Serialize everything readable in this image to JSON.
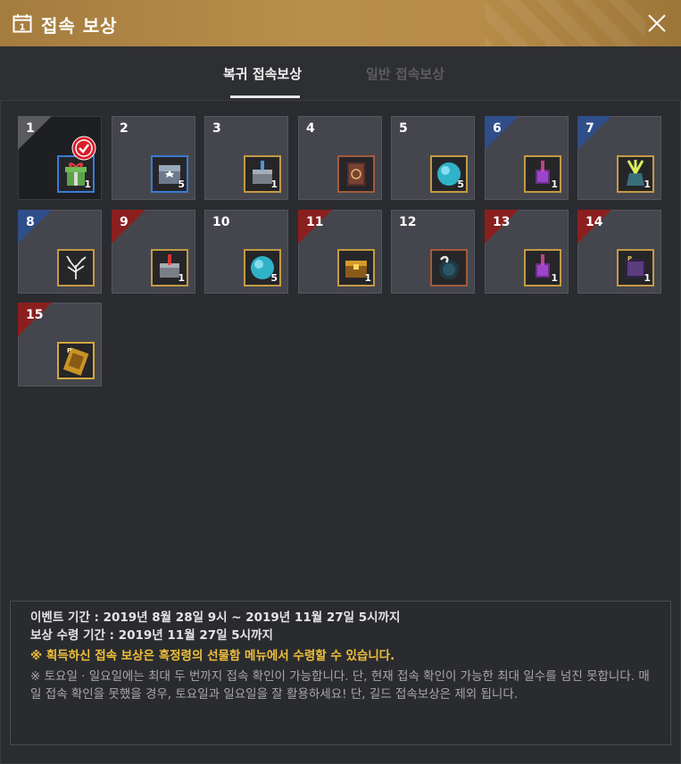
{
  "window": {
    "title": "접속 보상",
    "calendar_icon_label": "1"
  },
  "tabs": [
    {
      "label": "복귀 접속보상",
      "active": true
    },
    {
      "label": "일반 접속보상",
      "active": false
    }
  ],
  "rewards": [
    {
      "day": "1",
      "quantity": "1",
      "icon": "gift-box-icon",
      "ribbon": "gray",
      "frame": "blue",
      "claimed": true
    },
    {
      "day": "2",
      "quantity": "5",
      "icon": "silver-chest-icon",
      "ribbon": "none",
      "frame": "blue",
      "claimed": false
    },
    {
      "day": "3",
      "quantity": "1",
      "icon": "glowing-chest-icon",
      "ribbon": "none",
      "frame": "gold",
      "claimed": false
    },
    {
      "day": "4",
      "quantity": "",
      "icon": "spellbook-icon",
      "ribbon": "none",
      "frame": "brown",
      "claimed": false
    },
    {
      "day": "5",
      "quantity": "5",
      "icon": "blue-orb-icon",
      "ribbon": "none",
      "frame": "gold",
      "claimed": false
    },
    {
      "day": "6",
      "quantity": "1",
      "icon": "purple-cube-icon",
      "ribbon": "blue",
      "frame": "gold",
      "claimed": false
    },
    {
      "day": "7",
      "quantity": "1",
      "icon": "green-light-chest-icon",
      "ribbon": "blue",
      "frame": "gold",
      "claimed": false
    },
    {
      "day": "8",
      "quantity": "",
      "icon": "white-tree-icon",
      "ribbon": "blue",
      "frame": "gold",
      "claimed": false
    },
    {
      "day": "9",
      "quantity": "1",
      "icon": "red-light-chest-icon",
      "ribbon": "red",
      "frame": "gold",
      "claimed": false
    },
    {
      "day": "10",
      "quantity": "5",
      "icon": "blue-orb-icon",
      "ribbon": "none",
      "frame": "gold",
      "claimed": false
    },
    {
      "day": "11",
      "quantity": "1",
      "icon": "gold-chest-icon",
      "ribbon": "red",
      "frame": "gold",
      "claimed": false
    },
    {
      "day": "12",
      "quantity": "",
      "icon": "dark-orb-icon",
      "ribbon": "none",
      "frame": "brown",
      "claimed": false
    },
    {
      "day": "13",
      "quantity": "1",
      "icon": "purple-cube-icon",
      "ribbon": "red",
      "frame": "gold",
      "claimed": false
    },
    {
      "day": "14",
      "quantity": "1",
      "icon": "p-scroll-icon",
      "ribbon": "red",
      "frame": "gold",
      "claimed": false
    },
    {
      "day": "15",
      "quantity": "",
      "icon": "p-ticket-icon",
      "ribbon": "red",
      "frame": "yellow",
      "claimed": false
    }
  ],
  "notice": {
    "event_period": "이벤트 기간 : 2019년 8월 28일 9시 ~ 2019년 11월 27일 5시까지",
    "claim_period": "보상 수령 기간 : 2019년 11월 27일 5시까지",
    "highlight": "※ 획득하신 접속 보상은 흑정령의 선물함 메뉴에서 수령할 수 있습니다.",
    "detail": "※ 토요일 · 일요일에는 최대 두 번까지 접속 확인이 가능합니다. 단, 현재 접속 확인이 가능한 최대 일수를 넘진 못합니다. 매일 접속 확인을 못했을 경우, 토요일과 일요일을 잘 활용하세요! 단, 길드 접속보상은 제외 됩니다."
  },
  "colors": {
    "title_gold": "#b48a46",
    "highlight_yellow": "#f0c03a",
    "ribbon_blue": "#2f4e8a",
    "ribbon_red": "#8b1f1f",
    "check_red": "#d91e2a"
  }
}
